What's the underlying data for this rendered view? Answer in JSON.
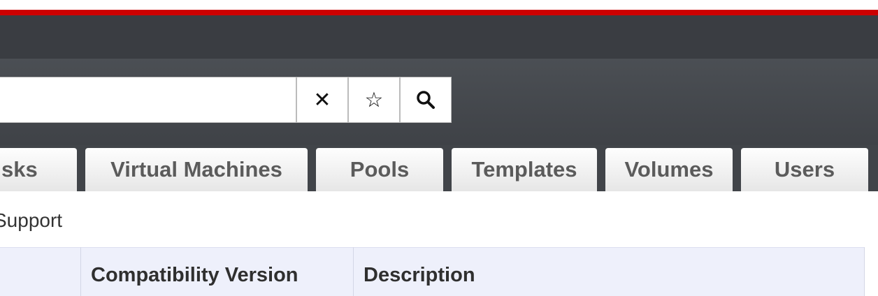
{
  "search": {
    "value": "",
    "placeholder": "",
    "clear_symbol": "✕",
    "bookmark_symbol": "☆",
    "search_symbol": "⚲"
  },
  "tabs": [
    {
      "label": "sks"
    },
    {
      "label": "Virtual Machines"
    },
    {
      "label": "Pools"
    },
    {
      "label": "Templates"
    },
    {
      "label": "Volumes"
    },
    {
      "label": "Users"
    }
  ],
  "page": {
    "subtitle": "Support"
  },
  "table": {
    "columns": [
      "Compatibility Version",
      "Description"
    ]
  },
  "colors": {
    "accent": "#cc0000",
    "masthead": "#3a3d42",
    "toolbar": "#45494e",
    "table_header": "#eef0fb"
  }
}
